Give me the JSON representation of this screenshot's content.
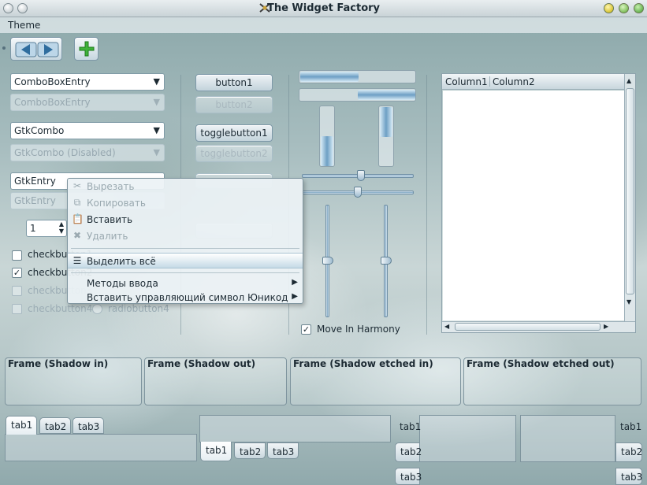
{
  "window": {
    "title": "The Widget Factory"
  },
  "menubar": {
    "theme": "Theme"
  },
  "left": {
    "combo_entry": "ComboBoxEntry",
    "combo_entry_disabled": "ComboBoxEntry",
    "gtk_combo": "GtkCombo",
    "gtk_combo_disabled": "GtkCombo (Disabled)",
    "gtk_entry": "GtkEntry",
    "gtk_entry_disabled": "GtkEntry",
    "spin_value": "1",
    "check1": "checkbutton1",
    "check2": "checkbutton2",
    "check3": "checkbutton3",
    "check4": "checkbutton4",
    "radio4": "radiobutton4"
  },
  "buttons": {
    "button1": "button1",
    "button2": "button2",
    "toggle1": "togglebutton1",
    "toggle2": "togglebutton2"
  },
  "scales": {
    "progress1": 0.5,
    "progress2": 0.5,
    "move_in_harmony": "Move In Harmony"
  },
  "tree": {
    "col1": "Column1",
    "col2": "Column2"
  },
  "frames": [
    "Frame (Shadow in)",
    "Frame (Shadow out)",
    "Frame (Shadow etched in)",
    "Frame (Shadow etched out)"
  ],
  "tabs": {
    "t1": "tab1",
    "t2": "tab2",
    "t3": "tab3"
  },
  "context_menu": {
    "cut": "Вырезать",
    "copy": "Копировать",
    "paste": "Вставить",
    "delete": "Удалить",
    "select_all": "Выделить всё",
    "input_methods": "Методы ввода",
    "insert_unicode": "Вставить управляющий символ Юникод"
  },
  "colors": {
    "accent": "#6d9fc4",
    "highlight": "#c5dae6"
  }
}
